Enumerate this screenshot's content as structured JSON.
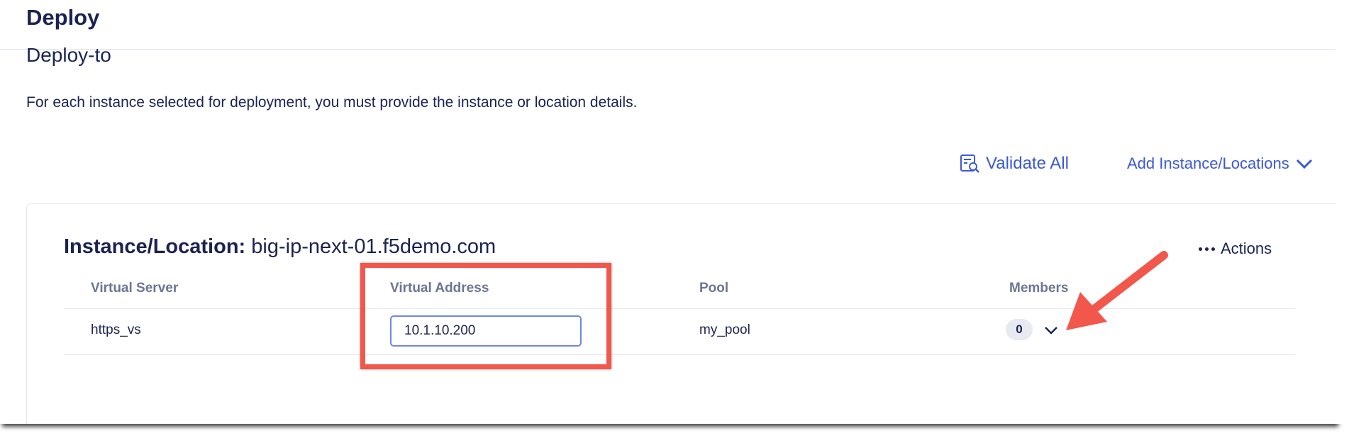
{
  "header": {
    "title": "Deploy"
  },
  "section": {
    "title": "Deploy-to",
    "description": "For each instance selected for deployment, you must provide the instance or location details."
  },
  "toolbar": {
    "validate_label": "Validate All",
    "validate_icon": "validate-report-icon",
    "add_label": "Add Instance/Locations",
    "add_icon": "chevron-down-icon"
  },
  "instance": {
    "label_key": "Instance/Location:",
    "label_value": "big-ip-next-01.f5demo.com",
    "actions_label": "Actions",
    "actions_icon": "more-dots-icon"
  },
  "table": {
    "columns": [
      "Virtual Server",
      "Virtual Address",
      "Pool",
      "Members"
    ],
    "rows": [
      {
        "virtual_server": "https_vs",
        "virtual_address": "10.1.10.200",
        "pool": "my_pool",
        "members": "0"
      }
    ]
  },
  "colors": {
    "accent": "#3b59d6",
    "title": "#1b2354",
    "highlight": "#f2574c"
  }
}
